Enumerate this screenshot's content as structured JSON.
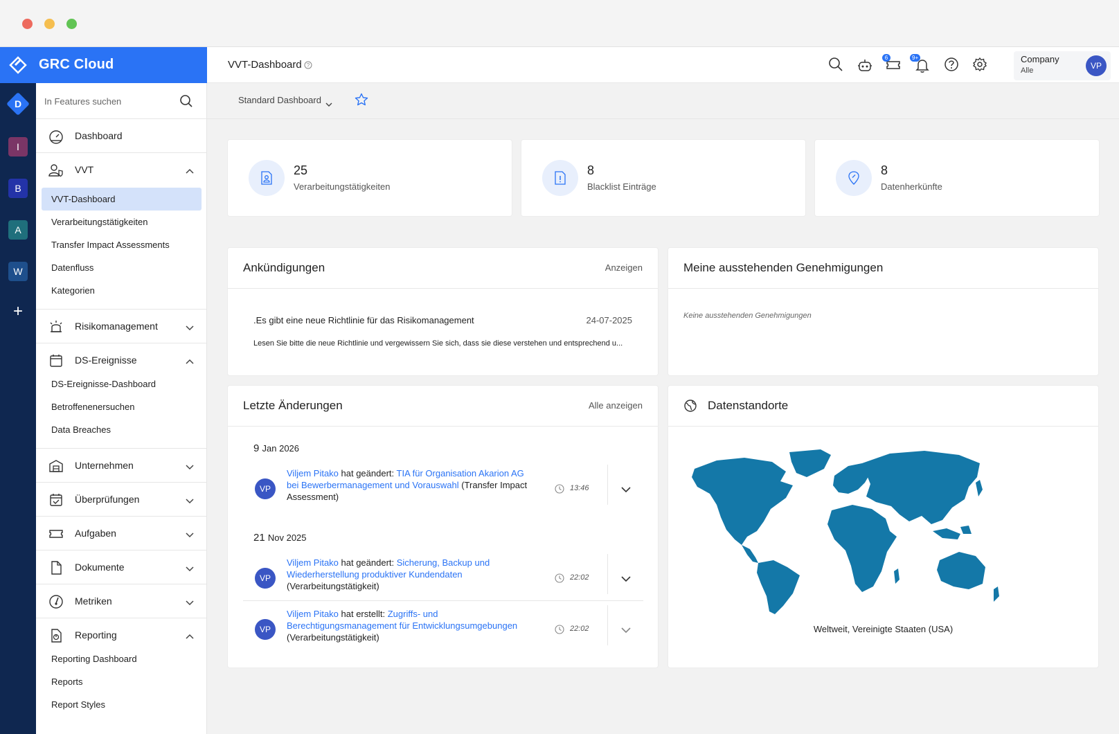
{
  "app": {
    "brand": "GRC Cloud"
  },
  "rail": {
    "workspaces": [
      {
        "letter": "D",
        "color": "#2a73f5"
      },
      {
        "letter": "I",
        "color": "#7a3566"
      },
      {
        "letter": "B",
        "color": "#2333a8"
      },
      {
        "letter": "A",
        "color": "#1f6f7c"
      },
      {
        "letter": "W",
        "color": "#1e4f8c"
      }
    ],
    "add_symbol": "+"
  },
  "sidebar": {
    "search_placeholder": "In Features suchen",
    "items": [
      {
        "label": "Dashboard",
        "icon": "speedometer-icon"
      },
      {
        "label": "VVT",
        "icon": "user-shield-icon",
        "expanded": true,
        "children": [
          "VVT-Dashboard",
          "Verarbeitungstätigkeiten",
          "Transfer Impact Assessments",
          "Datenfluss",
          "Kategorien"
        ]
      },
      {
        "label": "Risikomanagement",
        "icon": "alarm-icon",
        "expanded": false
      },
      {
        "label": "DS-Ereignisse",
        "icon": "calendar-icon",
        "expanded": true,
        "children": [
          "DS-Ereignisse-Dashboard",
          "Betroffenenersuchen",
          "Data Breaches"
        ]
      },
      {
        "label": "Unternehmen",
        "icon": "building-icon",
        "expanded": false
      },
      {
        "label": "Überprüfungen",
        "icon": "calendar-check-icon",
        "expanded": false
      },
      {
        "label": "Aufgaben",
        "icon": "ticket-icon",
        "expanded": false
      },
      {
        "label": "Dokumente",
        "icon": "document-icon",
        "expanded": false
      },
      {
        "label": "Metriken",
        "icon": "gauge-icon",
        "expanded": false
      },
      {
        "label": "Reporting",
        "icon": "report-icon",
        "expanded": true,
        "children": [
          "Reporting Dashboard",
          "Reports",
          "Report Styles"
        ]
      }
    ],
    "active_child": "VVT-Dashboard"
  },
  "topbar": {
    "title": "VVT-Dashboard",
    "badges": {
      "tasks": "6",
      "notifications": "9+"
    },
    "company": {
      "name": "Company",
      "scope": "Alle"
    },
    "user_initials": "VP"
  },
  "subbar": {
    "dashboard_select": "Standard Dashboard"
  },
  "stats": [
    {
      "value": "25",
      "label": "Verarbeitungstätigkeiten",
      "icon": "person-document-icon"
    },
    {
      "value": "8",
      "label": "Blacklist Einträge",
      "icon": "document-alert-icon"
    },
    {
      "value": "8",
      "label": "Datenherkünfte",
      "icon": "location-pin-icon"
    }
  ],
  "announcements": {
    "title": "Ankündigungen",
    "link": "Anzeigen",
    "item": {
      "title": ".Es gibt eine neue Richtlinie für das Risikomanagement",
      "date": "24-07-2025",
      "body": "Lesen Sie bitte die neue Richtlinie und vergewissern Sie sich, dass sie diese verstehen und entsprechend u..."
    }
  },
  "approvals": {
    "title": "Meine ausstehenden Genehmigungen",
    "empty": "Keine ausstehenden Genehmigungen"
  },
  "changes": {
    "title": "Letzte Änderungen",
    "link": "Alle anzeigen",
    "groups": [
      {
        "day": "9",
        "month_year": "Jan 2026",
        "entries": [
          {
            "initials": "VP",
            "user": "Viljem Pitako",
            "action": " hat geändert: ",
            "object": "TIA für Organisation Akarion AG bei Bewerbermanagement und Vorauswahl",
            "type": " (Transfer Impact Assessment)",
            "time": "13:46"
          }
        ]
      },
      {
        "day": "21",
        "month_year": "Nov 2025",
        "entries": [
          {
            "initials": "VP",
            "user": "Viljem Pitako",
            "action": " hat geändert: ",
            "object": "Sicherung, Backup und Wiederherstellung produktiver Kundendaten",
            "type": " (Verarbeitungstätigkeit)",
            "time": "22:02"
          },
          {
            "initials": "VP",
            "user": "Viljem Pitako",
            "action": " hat erstellt: ",
            "object": "Zugriffs- und Berechtigungsmanagement für Entwicklungsumgebungen",
            "type": " (Verarbeitungstätigkeit)",
            "time": "22:02"
          }
        ]
      }
    ]
  },
  "locations": {
    "title": "Datenstandorte",
    "caption": "Weltweit, Vereinigte Staaten (USA)",
    "map_color": "#1478a8"
  }
}
